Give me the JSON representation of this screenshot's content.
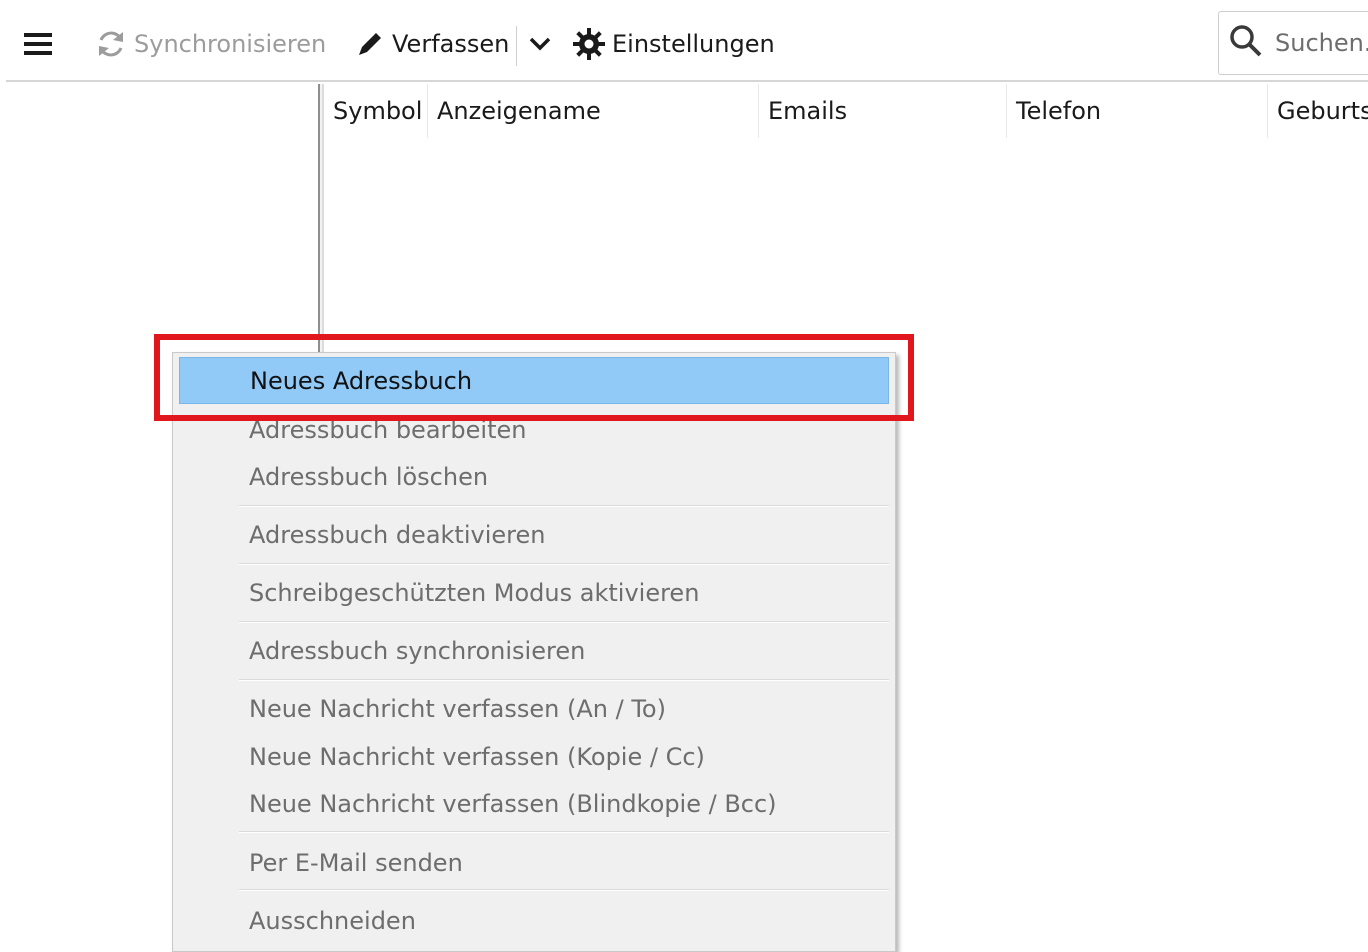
{
  "toolbar": {
    "menu_icon": "hamburger-menu-icon",
    "sync": {
      "label": "Synchronisieren",
      "icon": "sync-icon",
      "enabled": false
    },
    "compose": {
      "label": "Verfassen",
      "icon": "pencil-icon"
    },
    "compose_dropdown_icon": "chevron-down-icon",
    "settings": {
      "label": "Einstellungen",
      "icon": "gear-icon"
    },
    "search": {
      "placeholder": "Suchen...",
      "icon": "search-icon"
    }
  },
  "columns": [
    "Symbol",
    "Anzeigename",
    "Emails",
    "Telefon",
    "Geburtstag"
  ],
  "context_menu": {
    "items": [
      {
        "label": "Neues Adressbuch",
        "enabled": true,
        "highlighted": true
      },
      {
        "label": "Adressbuch bearbeiten",
        "enabled": false
      },
      {
        "label": "Adressbuch löschen",
        "enabled": false
      },
      {
        "label": "Adressbuch deaktivieren",
        "enabled": false
      },
      {
        "label": "Schreibgeschützten Modus aktivieren",
        "enabled": false
      },
      {
        "label": "Adressbuch synchronisieren",
        "enabled": false
      },
      {
        "label": "Neue Nachricht verfassen (An / To)",
        "enabled": false
      },
      {
        "label": "Neue Nachricht verfassen (Kopie / Cc)",
        "enabled": false
      },
      {
        "label": "Neue Nachricht verfassen (Blindkopie / Bcc)",
        "enabled": false
      },
      {
        "label": "Per E-Mail senden",
        "enabled": false
      },
      {
        "label": "Ausschneiden",
        "enabled": false
      }
    ]
  },
  "colors": {
    "highlight": "#91c9f7",
    "annotation_red": "#e2171e",
    "disabled_text": "#6d6d6d",
    "menu_background": "#f0f0f0"
  }
}
